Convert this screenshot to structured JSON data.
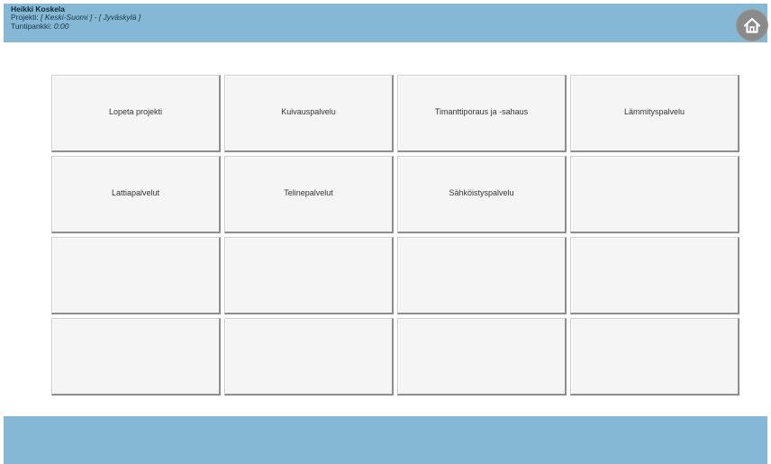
{
  "header": {
    "user_name": "Heikki Koskela",
    "project_label": "Projekti:",
    "project_value": "[ Keski-Suomi ] - [ Jyväskylä ]",
    "hours_label": "Tuntipankki:",
    "hours_value": "0:00",
    "home_icon": "home-icon"
  },
  "tiles": [
    "Lopeta projekti",
    "Kuivauspalvelu",
    "Timanttiporaus ja -sahaus",
    "Lämmityspalvelu",
    "Lattiapalvelut",
    "Telinepalvelut",
    "Sähköistyspalvelu",
    "",
    "",
    "",
    "",
    "",
    "",
    "",
    "",
    ""
  ],
  "colors": {
    "header_bar": "#85b8d4",
    "footer_bar": "#85b8d4",
    "tile_background": "#f5f5f5",
    "home_button": "#8a8a8a"
  }
}
